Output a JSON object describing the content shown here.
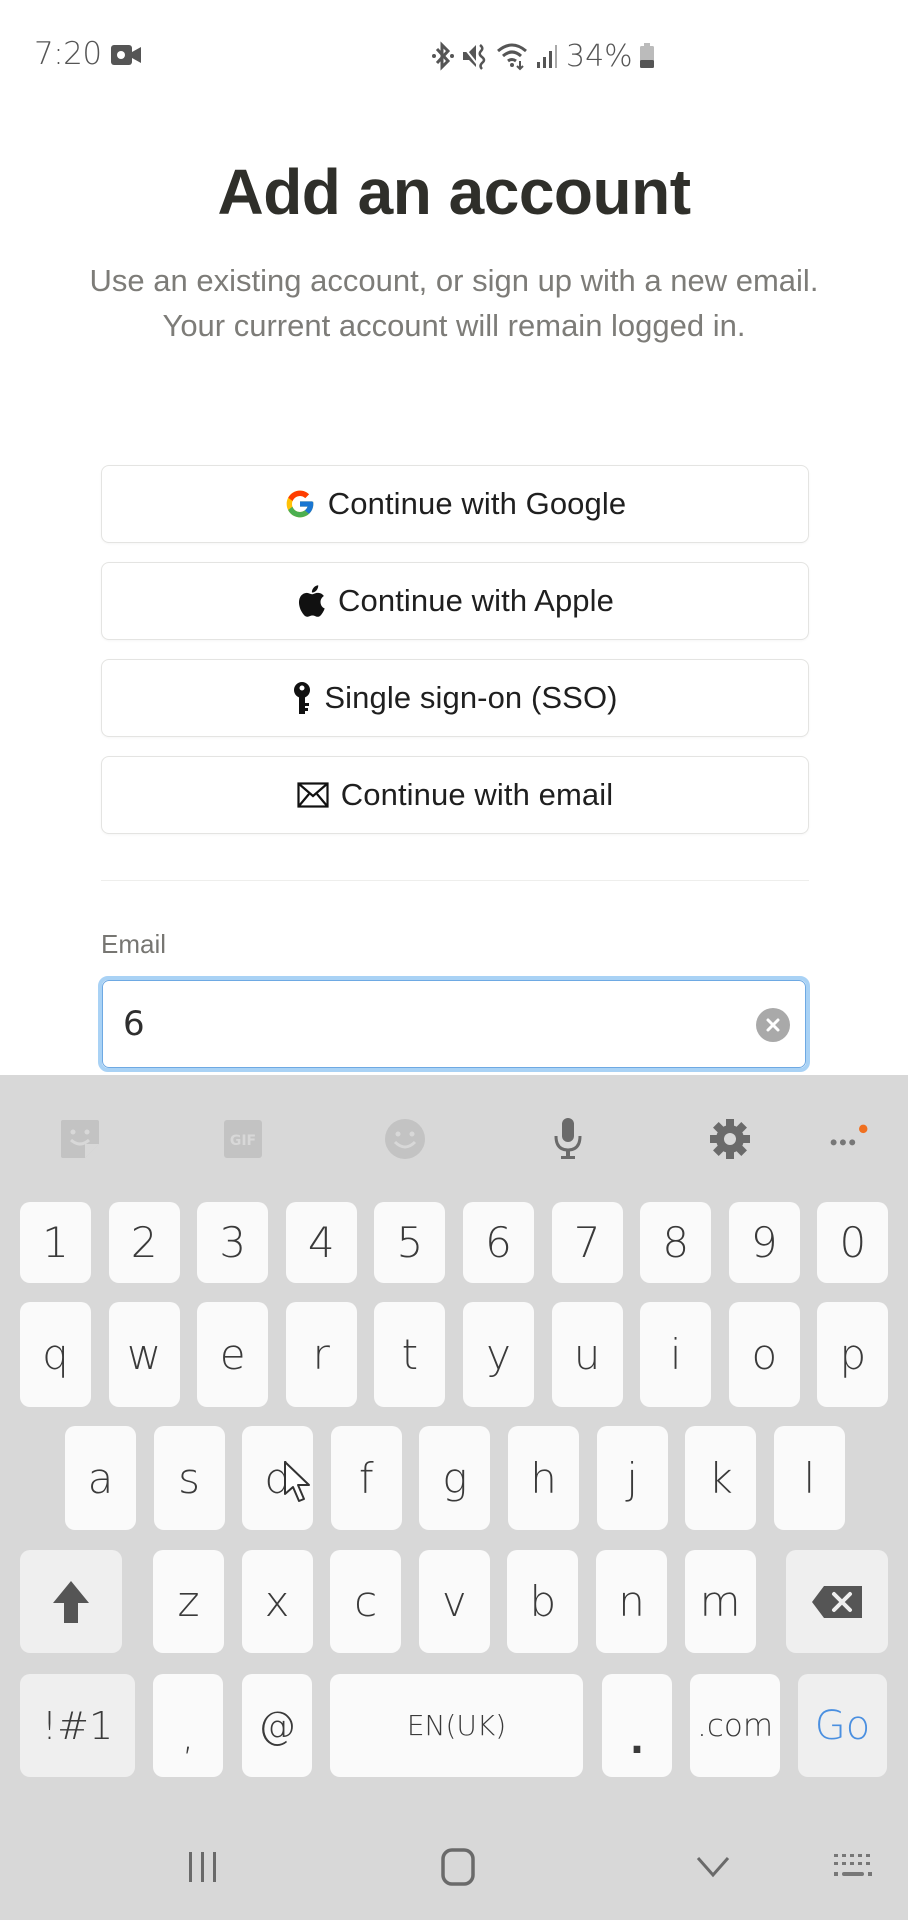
{
  "status_bar": {
    "time": "7:20",
    "battery_percent": "34%",
    "icons": [
      "video-camera-icon",
      "bluetooth-icon",
      "vibrate-mute-icon",
      "wifi-icon",
      "signal-icon",
      "battery-icon"
    ]
  },
  "header": {
    "title": "Add an account",
    "subtitle": "Use an existing account, or sign up with a new email. Your current account will remain logged in."
  },
  "auth_buttons": [
    {
      "id": "google",
      "label": "Continue with Google",
      "icon": "google-icon"
    },
    {
      "id": "apple",
      "label": "Continue with Apple",
      "icon": "apple-icon"
    },
    {
      "id": "sso",
      "label": "Single sign-on (SSO)",
      "icon": "key-icon"
    },
    {
      "id": "email",
      "label": "Continue with email",
      "icon": "mail-icon"
    }
  ],
  "email_form": {
    "label": "Email",
    "value": "6",
    "placeholder": ""
  },
  "keyboard": {
    "toolbar": [
      "sticker-icon",
      "gif-icon",
      "emoji-icon",
      "microphone-icon",
      "settings-icon",
      "more-icon"
    ],
    "rows": {
      "numbers": [
        "1",
        "2",
        "3",
        "4",
        "5",
        "6",
        "7",
        "8",
        "9",
        "0"
      ],
      "row1": [
        "q",
        "w",
        "e",
        "r",
        "t",
        "y",
        "u",
        "i",
        "o",
        "p"
      ],
      "row2": [
        "a",
        "s",
        "d",
        "f",
        "g",
        "h",
        "j",
        "k",
        "l"
      ],
      "row3": [
        "z",
        "x",
        "c",
        "v",
        "b",
        "n",
        "m"
      ]
    },
    "bottom": {
      "symbols": "!#1",
      "comma": ",",
      "at": "@",
      "space": "EN(UK)",
      "period": ".",
      "dotcom": ".com",
      "go": "Go"
    },
    "colors": {
      "background": "#d8d8d8",
      "key": "#fafafa",
      "go_accent": "#4a8fe0",
      "notification_dot": "#f07020"
    }
  },
  "nav_bar": [
    "recents-icon",
    "home-icon",
    "back-icon",
    "keyboard-switch-icon"
  ]
}
